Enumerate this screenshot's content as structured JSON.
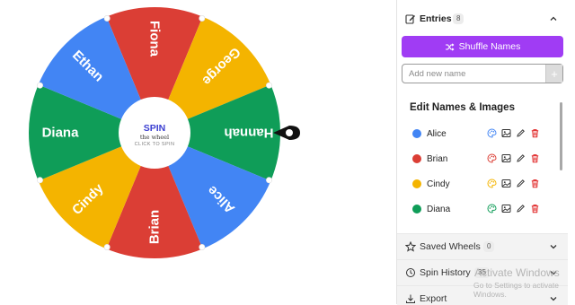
{
  "wheel": {
    "segments": [
      {
        "name": "Fiona",
        "color": "#db3e35"
      },
      {
        "name": "George",
        "color": "#f4b400"
      },
      {
        "name": "Hannah",
        "color": "#0f9d58"
      },
      {
        "name": "Alice",
        "color": "#4285f4"
      },
      {
        "name": "Brian",
        "color": "#db3e35"
      },
      {
        "name": "Cindy",
        "color": "#f4b400"
      },
      {
        "name": "Diana",
        "color": "#0f9d58"
      },
      {
        "name": "Ethan",
        "color": "#4285f4"
      }
    ],
    "hub": {
      "title": "SPIN",
      "subtitle": "the wheel",
      "caption": "CLICK TO SPIN"
    }
  },
  "panel": {
    "entries_label": "Entries",
    "entries_count": "8",
    "shuffle_label": "Shuffle Names",
    "add_placeholder": "Add new name",
    "edit_title": "Edit Names & Images",
    "names": [
      {
        "name": "Alice",
        "color": "#4285f4"
      },
      {
        "name": "Brian",
        "color": "#db3e35"
      },
      {
        "name": "Cindy",
        "color": "#f4b400"
      },
      {
        "name": "Diana",
        "color": "#0f9d58"
      }
    ],
    "saved_label": "Saved Wheels",
    "saved_count": "0",
    "history_label": "Spin History",
    "history_count": "35",
    "export_label": "Export"
  },
  "watermark": {
    "line1": "Activate Windows",
    "line2": "Go to Settings to activate Windows."
  }
}
